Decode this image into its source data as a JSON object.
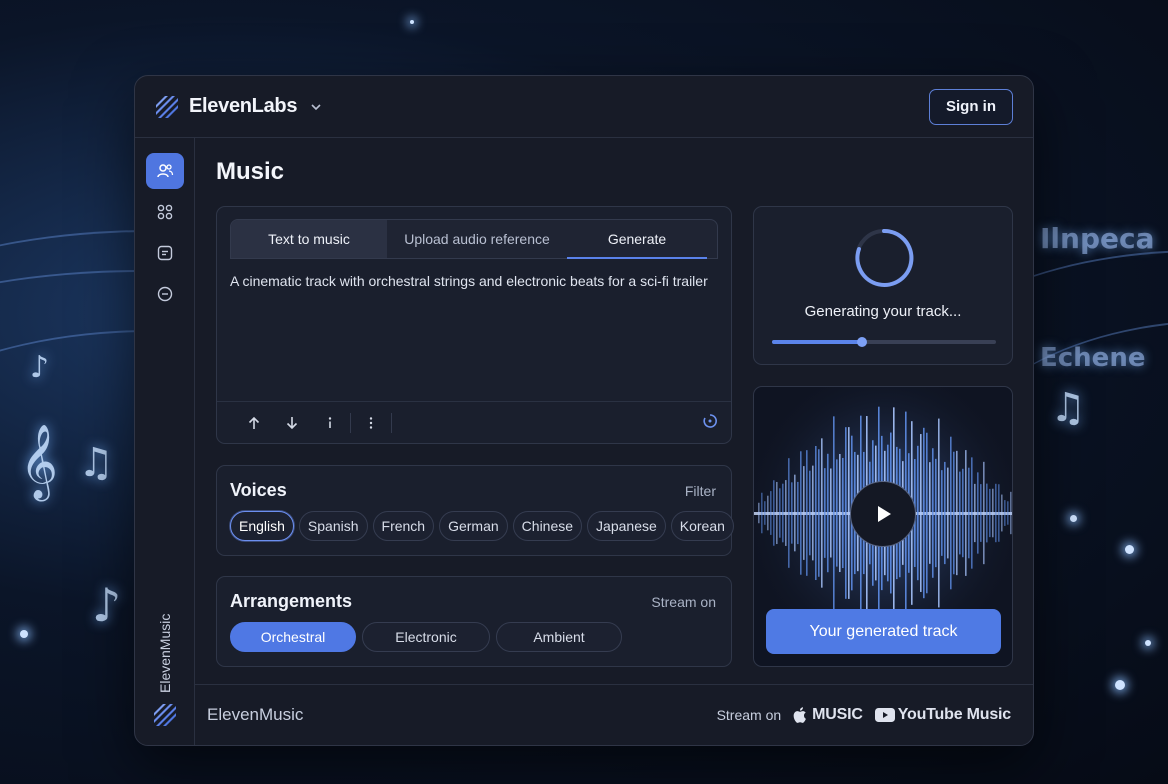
{
  "app": {
    "brand_name": "ElevenLabs",
    "sign_in_label": "Sign in"
  },
  "sidebar": {
    "items": [
      {
        "icon": "users-icon",
        "active": true
      },
      {
        "icon": "grid-icon",
        "active": false
      },
      {
        "icon": "document-icon",
        "active": false
      },
      {
        "icon": "minus-circle-icon",
        "active": false
      }
    ],
    "vertical_label": "ElevenMusic"
  },
  "page": {
    "title": "Music"
  },
  "editor": {
    "tabs": [
      "Text to music",
      "Upload audio reference",
      "Generate"
    ],
    "active_tab": "Generate",
    "prompt_text": "A cinematic track with orchestral strings and electronic beats for a sci-fi trailer"
  },
  "voices": {
    "title": "Voices",
    "filter_label": "Filter",
    "options": [
      "English",
      "Spanish",
      "French",
      "German",
      "Chinese",
      "Japanese",
      "Korean"
    ],
    "selected": "English"
  },
  "arrangements": {
    "title": "Arrangements",
    "link_label": "Stream on",
    "options": [
      "Orchestral",
      "Electronic",
      "Ambient"
    ],
    "selected": "Orchestral"
  },
  "generation": {
    "status_text": "Generating your track...",
    "progress": 0.4
  },
  "player": {
    "button_label": "Your generated track"
  },
  "footer": {
    "brand": "ElevenMusic",
    "stream_label": "Stream on",
    "services": [
      "MUSIC",
      "YouTube Music"
    ]
  },
  "colors": {
    "accent": "#4f78e4",
    "panel": "#1a1f2d",
    "background": "#0b1528"
  }
}
